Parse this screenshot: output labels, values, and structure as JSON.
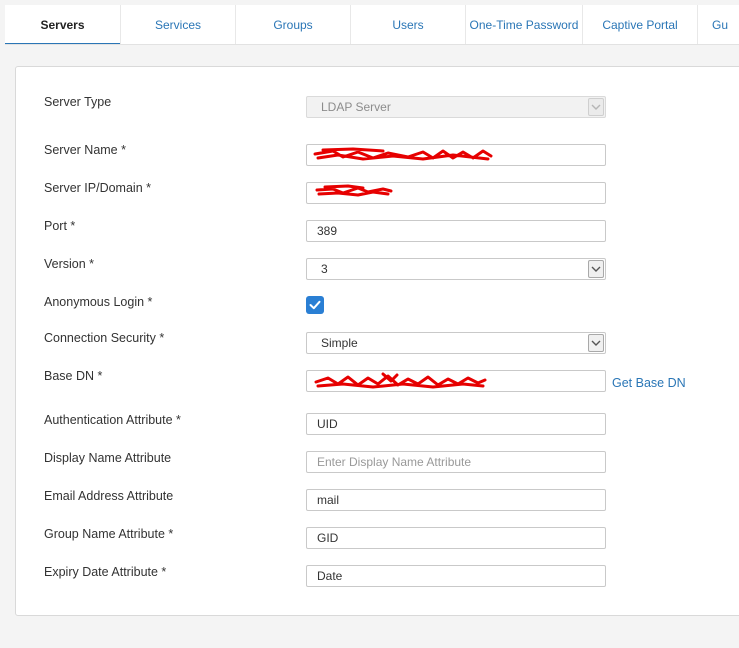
{
  "tabs": [
    {
      "label": "Servers",
      "active": true
    },
    {
      "label": "Services",
      "active": false
    },
    {
      "label": "Groups",
      "active": false
    },
    {
      "label": "Users",
      "active": false
    },
    {
      "label": "One-Time Password",
      "active": false
    },
    {
      "label": "Captive Portal",
      "active": false
    },
    {
      "label": "Gu",
      "active": false
    }
  ],
  "form": {
    "server_type": {
      "label": "Server Type",
      "value": "LDAP Server"
    },
    "server_name": {
      "label": "Server Name *",
      "value": ""
    },
    "server_ip": {
      "label": "Server IP/Domain *",
      "value": ""
    },
    "port": {
      "label": "Port *",
      "value": "389"
    },
    "version": {
      "label": "Version *",
      "value": "3"
    },
    "anonymous_login": {
      "label": "Anonymous Login *",
      "checked": true
    },
    "connection_security": {
      "label": "Connection Security *",
      "value": "Simple"
    },
    "base_dn": {
      "label": "Base DN *",
      "value": "",
      "action": "Get Base DN"
    },
    "auth_attribute": {
      "label": "Authentication Attribute *",
      "value": "UID"
    },
    "display_name_attribute": {
      "label": "Display Name Attribute",
      "value": "",
      "placeholder": "Enter Display Name Attribute"
    },
    "email_attribute": {
      "label": "Email Address Attribute",
      "value": "mail"
    },
    "group_name_attribute": {
      "label": "Group Name Attribute *",
      "value": "GID"
    },
    "expiry_date_attribute": {
      "label": "Expiry Date Attribute *",
      "value": "Date"
    }
  },
  "colors": {
    "accent": "#2a76b6",
    "checkbox": "#2a7fd4",
    "redaction": "#e60000"
  }
}
